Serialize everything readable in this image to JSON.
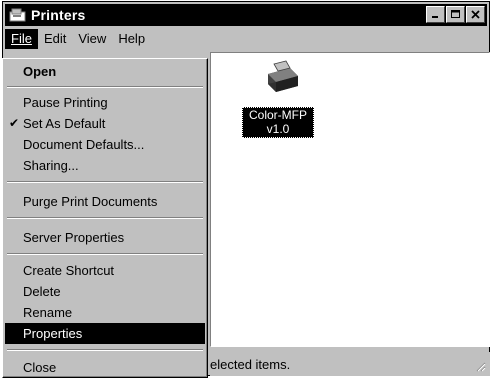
{
  "window": {
    "title": "Printers",
    "buttons": {
      "minimize": "_",
      "maximize": "□",
      "close": "×"
    }
  },
  "menubar": {
    "items": [
      {
        "label": "File",
        "active": true
      },
      {
        "label": "Edit",
        "active": false
      },
      {
        "label": "View",
        "active": false
      },
      {
        "label": "Help",
        "active": false
      }
    ]
  },
  "file_menu": {
    "open": "Open",
    "pause_printing": "Pause Printing",
    "set_as_default": "Set As Default",
    "set_as_default_checked": true,
    "document_defaults": "Document Defaults...",
    "sharing": "Sharing...",
    "purge_print_documents": "Purge Print Documents",
    "server_properties": "Server Properties",
    "create_shortcut": "Create Shortcut",
    "delete": "Delete",
    "rename": "Rename",
    "properties": "Properties",
    "close": "Close",
    "selected_item": "Properties"
  },
  "printers": [
    {
      "name_line1": "Color-MFP",
      "name_line2": "v1.0",
      "selected": true,
      "icon": "printer-icon"
    }
  ],
  "status": {
    "text": "elected items."
  }
}
